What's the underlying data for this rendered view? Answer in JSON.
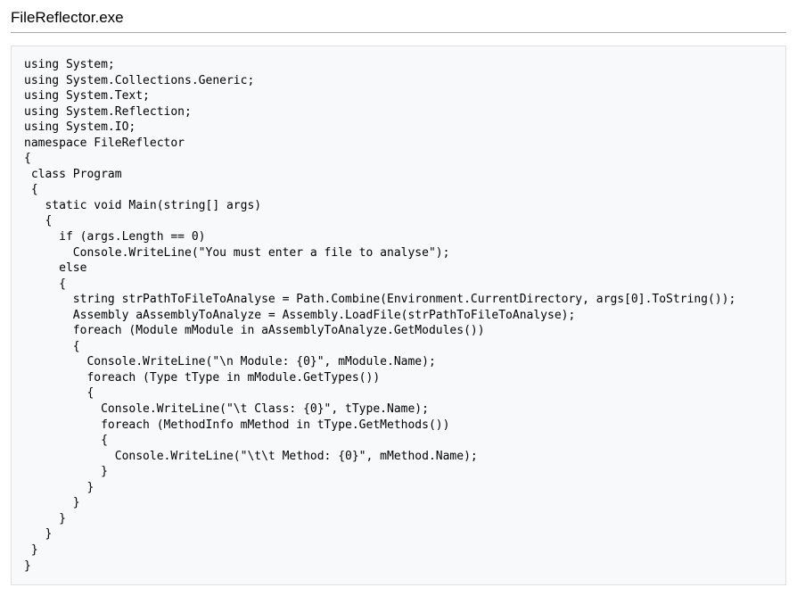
{
  "title": "FileReflector.exe",
  "code": "using System;\nusing System.Collections.Generic;\nusing System.Text;\nusing System.Reflection;\nusing System.IO;\nnamespace FileReflector\n{\n class Program\n {\n   static void Main(string[] args)\n   {\n     if (args.Length == 0)\n       Console.WriteLine(\"You must enter a file to analyse\");\n     else\n     {\n       string strPathToFileToAnalyse = Path.Combine(Environment.CurrentDirectory, args[0].ToString());\n       Assembly aAssemblyToAnalyze = Assembly.LoadFile(strPathToFileToAnalyse);\n       foreach (Module mModule in aAssemblyToAnalyze.GetModules())\n       {\n         Console.WriteLine(\"\\n Module: {0}\", mModule.Name);\n         foreach (Type tType in mModule.GetTypes())\n         {\n           Console.WriteLine(\"\\t Class: {0}\", tType.Name);\n           foreach (MethodInfo mMethod in tType.GetMethods())\n           {\n             Console.WriteLine(\"\\t\\t Method: {0}\", mMethod.Name);\n           }\n         }\n       }\n     }\n   }\n }\n}"
}
